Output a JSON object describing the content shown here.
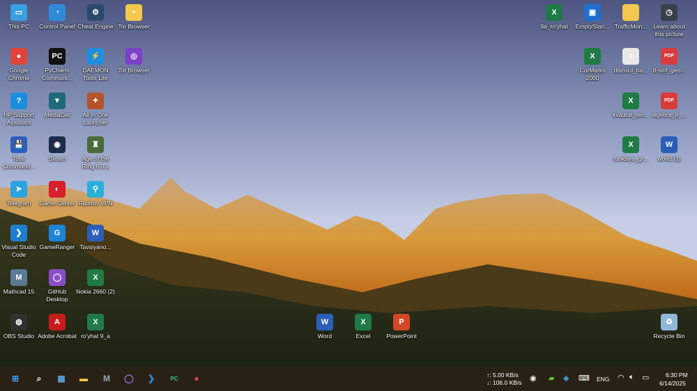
{
  "desktop": {
    "icons": [
      {
        "label": "This PC",
        "icon": "monitor-icon",
        "color": "#3aa0e0",
        "glyph": "▭"
      },
      {
        "label": "Control Panel",
        "icon": "control-panel-icon",
        "color": "#2f8ad8",
        "glyph": "◔"
      },
      {
        "label": "Cheat Engine",
        "icon": "cheat-engine-icon",
        "color": "#2b4a6a",
        "glyph": "⚙"
      },
      {
        "label": "Tor Browser",
        "icon": "folder-icon",
        "color": "#f2c94c",
        "glyph": "◓"
      },
      {
        "label": "Google Chrome",
        "icon": "chrome-icon",
        "color": "#e0443a",
        "glyph": "●"
      },
      {
        "label": "PyCharm Communi...",
        "icon": "pycharm-icon",
        "color": "#111",
        "glyph": "PC"
      },
      {
        "label": "DAEMON Tools Lite",
        "icon": "daemon-tools-icon",
        "color": "#1e8fe0",
        "glyph": "⚡"
      },
      {
        "label": "Tor Browser",
        "icon": "tor-icon",
        "color": "#7e3fc9",
        "glyph": "◎"
      },
      {
        "label": "HP Support Assistant",
        "icon": "hp-support-icon",
        "color": "#1b8ee0",
        "glyph": "?"
      },
      {
        "label": "MediaGet",
        "icon": "mediaget-icon",
        "color": "#1d6a7a",
        "glyph": "▼"
      },
      {
        "label": "All in One Launcher",
        "icon": "launcher-icon",
        "color": "#b5532a",
        "glyph": "✦"
      },
      {
        "label": "Total Command...",
        "icon": "total-commander-icon",
        "color": "#2a5fc0",
        "glyph": "💾"
      },
      {
        "label": "Steam",
        "icon": "steam-icon",
        "color": "#1b2d4a",
        "glyph": "◉"
      },
      {
        "label": "Age of the Ring 8.3.1",
        "icon": "age-of-ring-icon",
        "color": "#4a6a3a",
        "glyph": "♜"
      },
      {
        "label": "Telegram",
        "icon": "telegram-icon",
        "color": "#2aa3df",
        "glyph": "➤"
      },
      {
        "label": "Game Center",
        "icon": "game-center-icon",
        "color": "#d6202a",
        "glyph": "◐"
      },
      {
        "label": "Radmin VPN",
        "icon": "radmin-vpn-icon",
        "color": "#2ab0d8",
        "glyph": "⚲"
      },
      {
        "label": "Visual Studio Code",
        "icon": "vscode-icon",
        "color": "#1e7fd0",
        "glyph": "❯"
      },
      {
        "label": "GameRanger",
        "icon": "gameranger-icon",
        "color": "#1f84d8",
        "glyph": "G"
      },
      {
        "label": "Tavsiyano...",
        "icon": "word-doc-icon",
        "color": "#2b5fb7",
        "glyph": "W"
      },
      {
        "label": "Mathcad 15",
        "icon": "mathcad-icon",
        "color": "#5b7a95",
        "glyph": "M"
      },
      {
        "label": "GitHub Desktop",
        "icon": "github-icon",
        "color": "#8a4fc7",
        "glyph": "◯"
      },
      {
        "label": "Nokia 2660 (2)",
        "icon": "excel-doc-icon",
        "color": "#1f7a45",
        "glyph": "X"
      },
      {
        "label": "OBS Studio",
        "icon": "obs-icon",
        "color": "#303030",
        "glyph": "◍"
      },
      {
        "label": "Adobe Acrobat",
        "icon": "acrobat-icon",
        "color": "#c61b1b",
        "glyph": "A"
      },
      {
        "label": "ro'yhat 9_a",
        "icon": "excel-doc-icon",
        "color": "#1f7a45",
        "glyph": "X"
      },
      {
        "label": "Word",
        "icon": "word-icon",
        "color": "#2b5fb7",
        "glyph": "W"
      },
      {
        "label": "Excel",
        "icon": "excel-icon",
        "color": "#1f7a45",
        "glyph": "X"
      },
      {
        "label": "PowerPoint",
        "icon": "powerpoint-icon",
        "color": "#d24726",
        "glyph": "P"
      },
      {
        "label": "9a_ro'yhat",
        "icon": "excel-doc-icon",
        "color": "#1f7a45",
        "glyph": "X"
      },
      {
        "label": "EmptyStan...",
        "icon": "app-icon",
        "color": "#1e6fd0",
        "glyph": "▣"
      },
      {
        "label": "TrafficMon...",
        "icon": "folder-icon",
        "color": "#f2c94c",
        "glyph": ""
      },
      {
        "label": "Learn about this picture",
        "icon": "camera-icon",
        "color": "#3a3f4a",
        "glyph": "◷"
      },
      {
        "label": "CurMarks 2000",
        "icon": "excel-doc-icon",
        "color": "#1f7a45",
        "glyph": "X"
      },
      {
        "label": "discord_ba...",
        "icon": "text-file-icon",
        "color": "#e8e8e8",
        "glyph": "≡"
      },
      {
        "label": "8-sinf_geo...",
        "icon": "pdf-icon",
        "color": "#d93b3b",
        "glyph": "PDF"
      },
      {
        "label": "kvadrat_ten...",
        "icon": "excel-doc-icon",
        "color": "#1f7a45",
        "glyph": "X"
      },
      {
        "label": "algebra_8_...",
        "icon": "pdf-icon",
        "color": "#d93b3b",
        "glyph": "PDF"
      },
      {
        "label": "funksiya_gr...",
        "icon": "excel-doc-icon",
        "color": "#1f7a45",
        "glyph": "X"
      },
      {
        "label": "world (3)",
        "icon": "word-doc-icon",
        "color": "#2b5fb7",
        "glyph": "W"
      },
      {
        "label": "Recycle Bin",
        "icon": "recycle-bin-icon",
        "color": "#8fb8d8",
        "glyph": "♻"
      }
    ]
  },
  "taskbar": {
    "apps": [
      {
        "name": "start",
        "icon": "windows-start-icon",
        "glyph": "⊞",
        "color": "#3aa0ff"
      },
      {
        "name": "search",
        "icon": "search-icon",
        "glyph": "⌕",
        "color": "#fff"
      },
      {
        "name": "store",
        "icon": "store-icon",
        "glyph": "▦",
        "color": "#5aa0e0"
      },
      {
        "name": "explorer",
        "icon": "file-explorer-icon",
        "glyph": "▬",
        "color": "#f2c94c"
      },
      {
        "name": "mathcad",
        "icon": "mathcad-icon",
        "glyph": "M",
        "color": "#9ab"
      },
      {
        "name": "github",
        "icon": "github-icon",
        "glyph": "◯",
        "color": "#a070e0"
      },
      {
        "name": "vscode",
        "icon": "vscode-icon",
        "glyph": "❯",
        "color": "#2a8fe8"
      },
      {
        "name": "pycharm",
        "icon": "pycharm-icon",
        "glyph": "PC",
        "color": "#2fd07a"
      },
      {
        "name": "chrome",
        "icon": "chrome-icon",
        "glyph": "●",
        "color": "#e0443a"
      }
    ],
    "net_up": "↑: 5.00 KB/s",
    "net_down": "↓: 106.0 KB/s",
    "language": "ENG",
    "time": "6:30 PM",
    "date": "6/14/2025"
  }
}
